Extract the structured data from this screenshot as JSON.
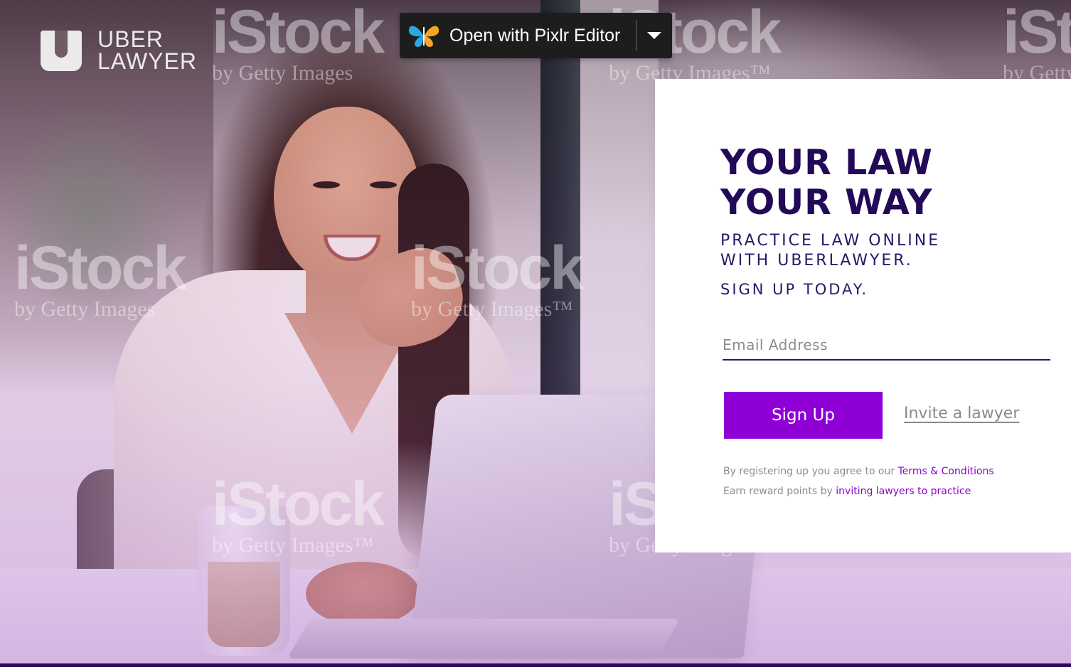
{
  "brand": {
    "logo_line1": "UBER",
    "logo_line2": "LAWYER",
    "primary_color": "#8e00d6",
    "headline_color": "#230a59"
  },
  "pixlr_overlay": {
    "label": "Open with Pixlr Editor",
    "icon": "butterfly-icon",
    "menu_icon": "caret-down-icon"
  },
  "watermarks": {
    "main": "iStock",
    "sub": "by Getty Images",
    "sub_tm": "by Getty Images™"
  },
  "signup_card": {
    "headline_line1": "YOUR LAW",
    "headline_line2": "YOUR WAY",
    "subhead_line1": "PRACTICE LAW ONLINE",
    "subhead_line2": "WITH UBERLAWYER.",
    "cta_line": "SIGN UP TODAY.",
    "email_placeholder": "Email Address",
    "email_value": "",
    "signup_button": "Sign Up",
    "invite_link": "Invite a lawyer",
    "terms_prefix": "By registering up you agree to our ",
    "terms_link": "Terms & Conditions",
    "reward_prefix": "Earn reward points by ",
    "reward_link": "inviting lawyers to practice"
  }
}
